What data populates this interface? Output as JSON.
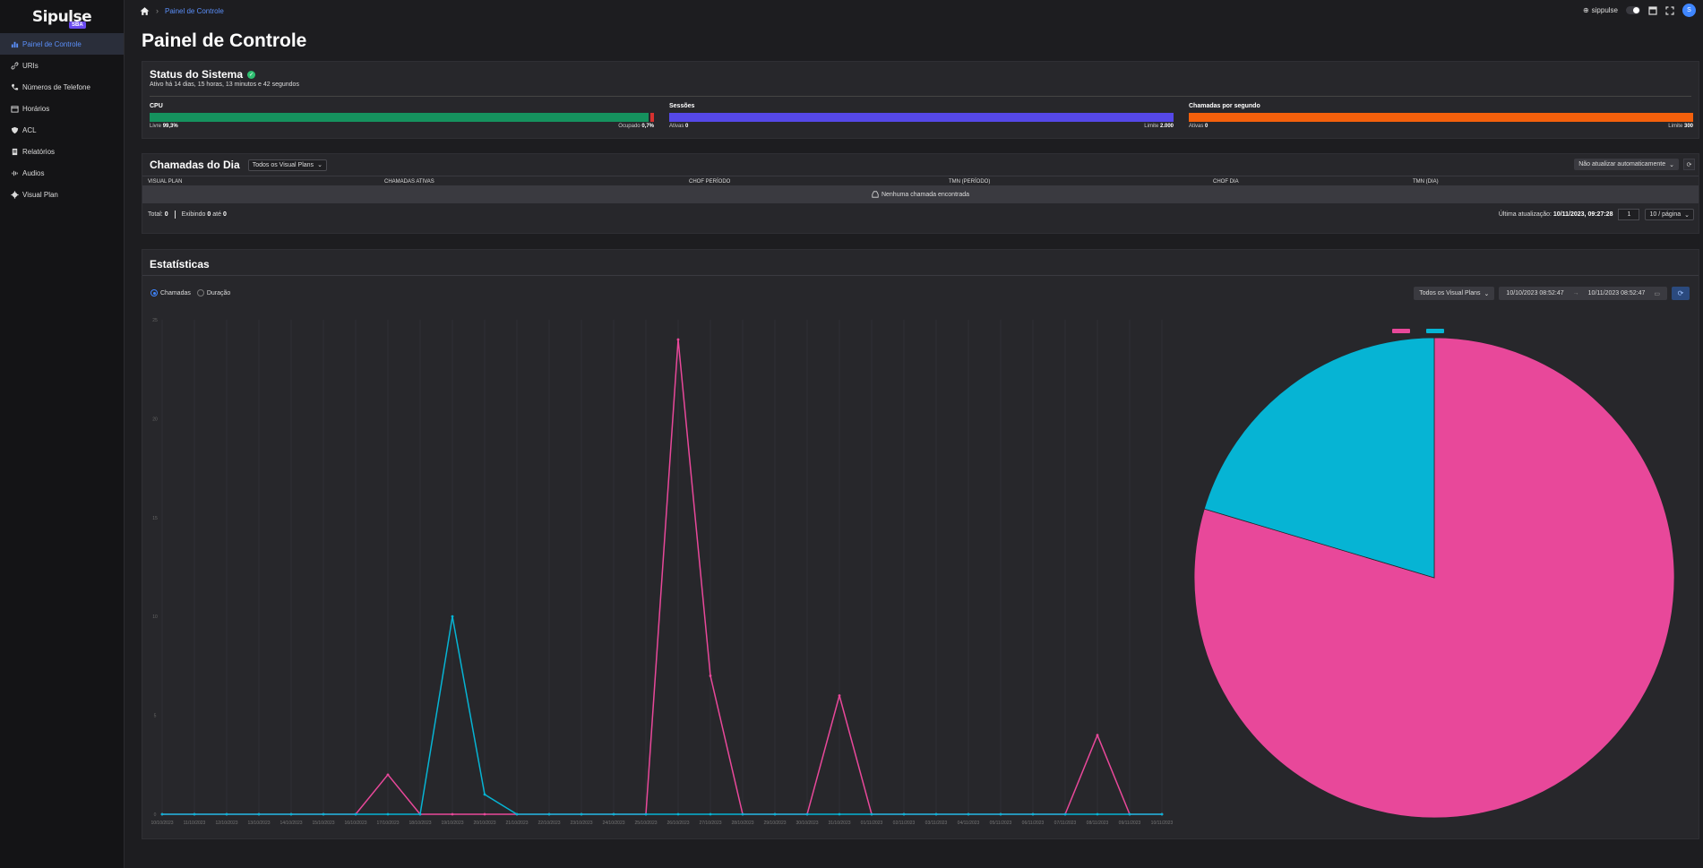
{
  "app": {
    "logo_text": "Sipulse",
    "logo_badge": "SBA"
  },
  "sidebar": {
    "items": [
      {
        "label": "Painel de Controle",
        "icon": "chart-icon",
        "active": true
      },
      {
        "label": "URIs",
        "icon": "link-icon"
      },
      {
        "label": "Números de Telefone",
        "icon": "phone-icon"
      },
      {
        "label": "Horários",
        "icon": "calendar-icon"
      },
      {
        "label": "ACL",
        "icon": "shield-icon"
      },
      {
        "label": "Relatórios",
        "icon": "report-icon"
      },
      {
        "label": "Audios",
        "icon": "audio-icon"
      },
      {
        "label": "Visual Plan",
        "icon": "gear-icon"
      }
    ]
  },
  "topbar": {
    "breadcrumb_current": "Painel de Controle",
    "user": "sippulse",
    "avatar": "S"
  },
  "page": {
    "title": "Painel de Controle"
  },
  "status": {
    "title": "Status do Sistema",
    "uptime": "Ativo há 14 dias, 15 horas, 13 minutos e 42 segundos",
    "cpu": {
      "label": "CPU",
      "free_label": "Livre",
      "free_value": "99,3%",
      "used_label": "Ocupado",
      "used_value": "0,7%",
      "used_fraction": 0.007,
      "color_free": "#15925e",
      "color_used": "#d6312f"
    },
    "sessions": {
      "label": "Sessões",
      "left_label": "Ativas",
      "left_value": "0",
      "right_label": "Limite",
      "right_value": "2.000",
      "color": "#5548e8"
    },
    "cps": {
      "label": "Chamadas por segundo",
      "left_label": "Ativas",
      "left_value": "0",
      "right_label": "Limite",
      "right_value": "300",
      "color": "#f4600c"
    }
  },
  "calls": {
    "title": "Chamadas do Dia",
    "plan_select": "Todos os Visual Plans",
    "refresh_select": "Não atualizar automaticamente",
    "columns": [
      "VISUAL PLAN",
      "CHAMADAS ATIVAS",
      "CHOF PERÍODO",
      "TMN (PERÍODO)",
      "CHOF DIA",
      "TMN (DIA)"
    ],
    "empty_text": "Nenhuma chamada encontrada",
    "total_label": "Total:",
    "total_value": "0",
    "showing_prefix": "Exibindo",
    "showing_from": "0",
    "showing_mid": "até",
    "showing_to": "0",
    "last_update_label": "Última atualização:",
    "last_update_value": "10/11/2023, 09:27:28",
    "page": "1",
    "page_size": "10 / página"
  },
  "stats": {
    "title": "Estatísticas",
    "radio_calls": "Chamadas",
    "radio_duration": "Duração",
    "plan_select": "Todos os Visual Plans",
    "date_from": "10/10/2023 08:52:47",
    "date_to": "10/11/2023 08:52:47"
  },
  "chart_data": [
    {
      "type": "line",
      "x": [
        "10/10/2023",
        "11/10/2023",
        "12/10/2023",
        "13/10/2023",
        "14/10/2023",
        "15/10/2023",
        "16/10/2023",
        "17/10/2023",
        "18/10/2023",
        "19/10/2023",
        "20/10/2023",
        "21/10/2023",
        "22/10/2023",
        "23/10/2023",
        "24/10/2023",
        "25/10/2023",
        "26/10/2023",
        "27/10/2023",
        "28/10/2023",
        "29/10/2023",
        "30/10/2023",
        "31/10/2023",
        "01/11/2023",
        "02/11/2023",
        "03/11/2023",
        "04/11/2023",
        "05/11/2023",
        "06/11/2023",
        "07/11/2023",
        "08/11/2023",
        "09/11/2023",
        "10/11/2023"
      ],
      "ylim": [
        0,
        25
      ],
      "yticks": [
        0,
        5,
        10,
        15,
        20,
        25
      ],
      "series": [
        {
          "color": "#e8489a",
          "values": [
            0,
            0,
            0,
            0,
            0,
            0,
            0,
            2,
            0,
            0,
            0,
            0,
            0,
            0,
            0,
            0,
            24,
            7,
            0,
            0,
            0,
            6,
            0,
            0,
            0,
            0,
            0,
            0,
            0,
            4,
            0,
            0
          ]
        },
        {
          "color": "#06b4d4",
          "values": [
            0,
            0,
            0,
            0,
            0,
            0,
            0,
            0,
            0,
            10,
            1,
            0,
            0,
            0,
            0,
            0,
            0,
            0,
            0,
            0,
            0,
            0,
            0,
            0,
            0,
            0,
            0,
            0,
            0,
            0,
            0,
            0
          ]
        }
      ]
    },
    {
      "type": "pie",
      "slices": [
        {
          "value": 43,
          "color": "#e8489a"
        },
        {
          "value": 11,
          "color": "#06b4d4"
        }
      ]
    }
  ]
}
